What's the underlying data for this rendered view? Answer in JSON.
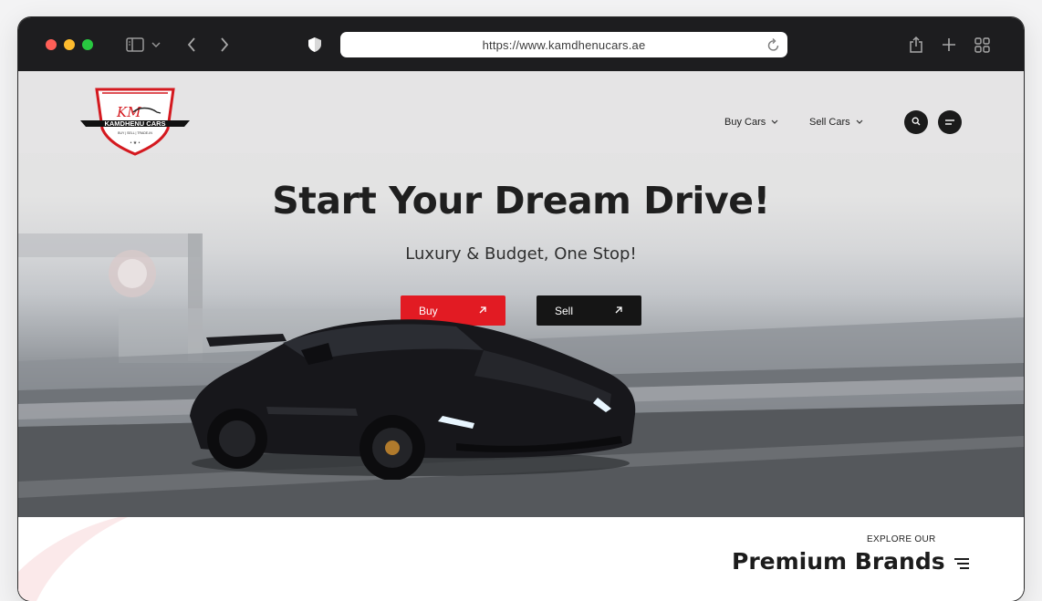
{
  "browser": {
    "url": "https://www.kamdhenucars.ae",
    "icons": [
      "sidebar-icon",
      "chevron-down-icon",
      "back-icon",
      "forward-icon",
      "shield-icon",
      "reload-icon",
      "share-icon",
      "new-tab-icon",
      "tab-overview-icon"
    ]
  },
  "site": {
    "logo": {
      "initials": "KM",
      "name": "KAMDHENU CARS",
      "tagline": "BUY | SELL | TRADE-IN"
    },
    "nav": [
      {
        "label": "Buy Cars"
      },
      {
        "label": "Sell Cars"
      }
    ],
    "hero": {
      "title": "Start Your Dream Drive!",
      "subtitle": "Luxury & Budget, One Stop!",
      "buttons": {
        "buy": "Buy",
        "sell": "Sell"
      }
    },
    "brands": {
      "eyebrow": "EXPLORE OUR",
      "title": "Premium Brands"
    }
  },
  "colors": {
    "accent_red": "#e21b23",
    "dark": "#151515"
  }
}
